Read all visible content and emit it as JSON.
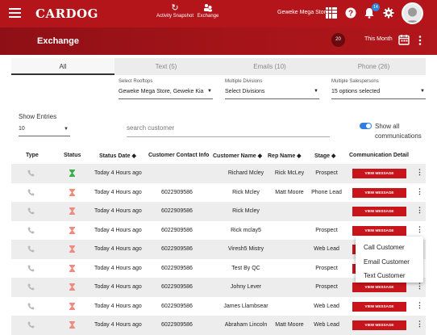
{
  "header": {
    "logo": "CARDOG",
    "nav": [
      {
        "label": "Activity Snapshot",
        "icon": "refresh-icon"
      },
      {
        "label": "Exchange",
        "icon": "exchange-icon"
      }
    ],
    "store": "Geweke Mega Store",
    "notification_count": "14",
    "icons": [
      "grid-icon",
      "help-icon",
      "bell-icon",
      "gear-icon",
      "avatar"
    ]
  },
  "subheader": {
    "title": "Exchange",
    "count": "20",
    "period": "This Month"
  },
  "tabs": [
    "All",
    "Text (5)",
    "Emails (10)",
    "Phone (26)"
  ],
  "filters": {
    "rooftops": {
      "label": "Select Rooftops",
      "value": "Geweke Mega Store, Geweke Kia"
    },
    "divisions": {
      "label": "Multiple Divisions",
      "value": "Select Divisions"
    },
    "salespersons": {
      "label": "Multiple Salespersons",
      "value": "15 options selected"
    }
  },
  "entries": {
    "label": "Show Entries",
    "value": "10"
  },
  "search": {
    "placeholder": "search customer"
  },
  "show_all": {
    "label": "Show all communications",
    "on": true
  },
  "table": {
    "headers": [
      "Type",
      "Status",
      "Status Date",
      "Customer Contact Info",
      "Customer Name",
      "Rep Name",
      "Stage",
      "Communication Detail"
    ],
    "sortable": [
      "Status Date",
      "Customer Name",
      "Rep Name",
      "Stage"
    ],
    "button_label": "VIEW MESSAGE",
    "rows": [
      {
        "status": "green",
        "date": "Today 4 Hours ago",
        "contact": "",
        "name": "Richard Mcley",
        "rep": "Rick McLey",
        "stage": "Prospect"
      },
      {
        "status": "red",
        "date": "Today 4 Hours ago",
        "contact": "6022909586",
        "name": "Rick Mcley",
        "rep": "Matt Moore",
        "stage": "Phone Lead"
      },
      {
        "status": "red",
        "date": "Today 4 Hours ago",
        "contact": "6022909586",
        "name": "Rick Mcley",
        "rep": "",
        "stage": ""
      },
      {
        "status": "red",
        "date": "Today 4 Hours ago",
        "contact": "6022909586",
        "name": "Rick mclay5",
        "rep": "",
        "stage": "Prospect"
      },
      {
        "status": "red",
        "date": "Today 4 Hours ago",
        "contact": "6022909586",
        "name": "Viresh5 Mistry",
        "rep": "",
        "stage": "Web Lead"
      },
      {
        "status": "red",
        "date": "Today 4 Hours ago",
        "contact": "6022909586",
        "name": "Test By QC",
        "rep": "",
        "stage": "Prospect"
      },
      {
        "status": "red",
        "date": "Today 4 Hours ago",
        "contact": "6022909586",
        "name": "Johny Lever",
        "rep": "",
        "stage": "Prospect"
      },
      {
        "status": "red",
        "date": "Today 4 Hours ago",
        "contact": "6022909586",
        "name": "James Llambsear",
        "rep": "",
        "stage": "Web Lead"
      },
      {
        "status": "red",
        "date": "Today 4 Hours ago",
        "contact": "6022909586",
        "name": "Abraham Lincoln",
        "rep": "Matt Moore",
        "stage": "Web Lead"
      }
    ]
  },
  "context_menu": [
    "Call Customer",
    "Email Customer",
    "Text Customer"
  ],
  "colors": {
    "brand": "#b3151b",
    "status_green": "#34b04a",
    "status_red": "#f08a7e",
    "link_blue": "#2f7ee0"
  }
}
